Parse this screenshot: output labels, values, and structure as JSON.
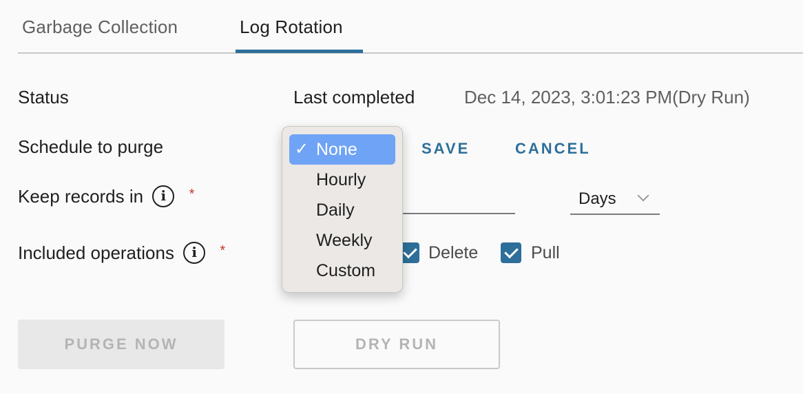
{
  "tabs": [
    {
      "label": "Garbage Collection",
      "active": false
    },
    {
      "label": "Log Rotation",
      "active": true
    }
  ],
  "accent_color": "#2d6f9a",
  "status": {
    "label": "Status",
    "sublabel": "Last completed",
    "value": "Dec 14, 2023, 3:01:23 PM(Dry Run)"
  },
  "schedule": {
    "label": "Schedule to purge",
    "save_label": "SAVE",
    "cancel_label": "CANCEL",
    "menu": {
      "check_glyph": "✓",
      "options": [
        "None",
        "Hourly",
        "Daily",
        "Weekly",
        "Custom"
      ],
      "selected": "None"
    }
  },
  "keep_records": {
    "label": "Keep records in",
    "info_icon": "i",
    "required_mark": "*",
    "unit": "Days"
  },
  "operations": {
    "label": "Included operations",
    "info_icon": "i",
    "required_mark": "*",
    "items": [
      {
        "label": "Delete",
        "checked": true
      },
      {
        "label": "Pull",
        "checked": true
      }
    ]
  },
  "buttons": {
    "purge_now": "PURGE NOW",
    "dry_run": "DRY RUN"
  }
}
